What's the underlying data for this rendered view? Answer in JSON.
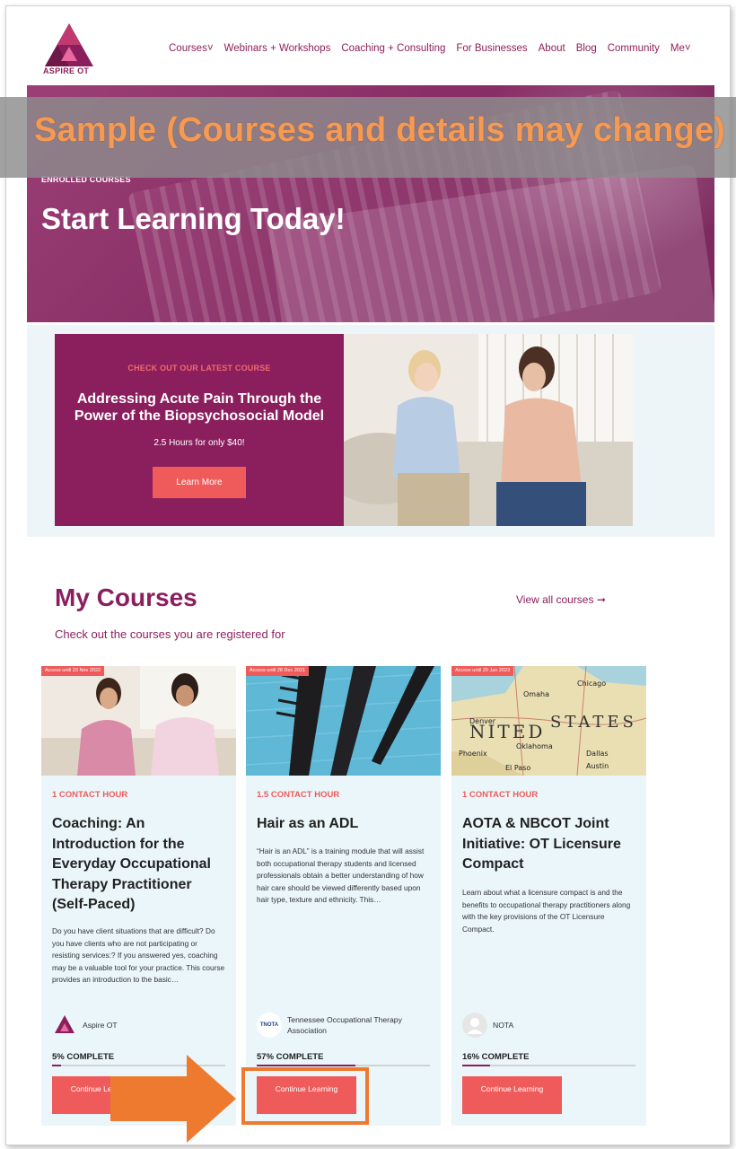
{
  "header": {
    "logo_text": "ASPIRE OT",
    "nav": [
      "Courses˅",
      "Webinars + Workshops",
      "Coaching + Consulting",
      "For Businesses",
      "About",
      "Blog",
      "Community",
      "Me˅"
    ]
  },
  "hero": {
    "label": "ENROLLED COURSES",
    "title": "Start Learning Today!"
  },
  "overlay": {
    "banner_text": "Sample (Courses and details may change)"
  },
  "featured": {
    "kicker": "CHECK OUT OUR LATEST COURSE",
    "title": "Addressing Acute Pain Through the Power of the Biopsychosocial Model",
    "subtitle": "2.5 Hours for only $40!",
    "button": "Learn More"
  },
  "my_courses": {
    "title": "My Courses",
    "subtitle": "Check out the courses you are registered for",
    "view_all": "View all courses ➞",
    "cards": [
      {
        "badge": "Access until 23 Nov 2022",
        "hours": "1 CONTACT HOUR",
        "title": "Coaching: An Introduction for the Everyday Occupational Therapy Practitioner (Self-Paced)",
        "description": "Do you have client situations that are difficult? Do you have clients who are not participating or resisting services:? If you answered yes, coaching may be a valuable tool for your practice. This course provides an introduction to the basic…",
        "author": "Aspire OT",
        "progress_label": "5% COMPLETE",
        "progress": 0.05,
        "button": "Continue Learning"
      },
      {
        "badge": "Access until 28 Dec 2021",
        "hours": "1.5 CONTACT HOUR",
        "title": "Hair as an ADL",
        "description": "“Hair is an ADL” is a training module that will assist both occupational therapy students and licensed professionals obtain a better understanding of how hair care should be viewed differently based upon hair type, texture and ethnicity. This…",
        "author": "Tennessee Occupational Therapy Association",
        "author_logo": "TNOTA",
        "progress_label": "57% COMPLETE",
        "progress": 0.57,
        "button": "Continue Learning"
      },
      {
        "badge": "Access until 20 Jan 2023",
        "hours": "1 CONTACT HOUR",
        "title": "AOTA & NBCOT Joint Initiative: OT Licensure Compact",
        "description": "Learn about what a licensure compact is and the benefits to occupational therapy practitioners along with the key provisions of the OT Licensure Compact.",
        "author": "NOTA",
        "progress_label": "16% COMPLETE",
        "progress": 0.16,
        "button": "Continue Learning"
      }
    ]
  },
  "colors": {
    "brand": "#8b1f5e",
    "accent": "#ef5b5b",
    "card_bg": "#eaf6fa",
    "annotation": "#ee7a30"
  },
  "icons": [
    "aspire-logo-icon",
    "arrow-right-icon",
    "default-avatar-icon"
  ]
}
